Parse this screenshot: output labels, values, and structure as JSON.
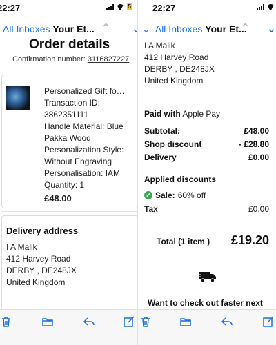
{
  "status_bar": {
    "left_time": "22:27",
    "right_time": "22:27",
    "battery": "5"
  },
  "nav": {
    "back_label": "All Inboxes",
    "subject": "Your Et..."
  },
  "order": {
    "title": "Order details",
    "confirmation_label": "Confirmation number:",
    "confirmation_number": "3116827227",
    "item": {
      "name": "Personalized Gift for ...",
      "transaction_label": "Transaction ID:",
      "transaction_id": "3862351111",
      "details": [
        "Handle Material: Blue",
        "Pakka Wood",
        "Personalization Style:",
        "Without Engraving",
        "Personalisation: IAM",
        "Quantity: 1"
      ],
      "price": "£48.00"
    }
  },
  "delivery": {
    "heading": "Delivery address",
    "lines": [
      "I A Malik",
      "412 Harvey Road",
      "DERBY , DE248JX",
      "United Kingdom"
    ]
  },
  "right_address": {
    "lines": [
      "I A Malik",
      "412 Harvey Road",
      "DERBY , DE248JX",
      "United Kingdom"
    ]
  },
  "payment": {
    "paid_label": "Paid with",
    "paid_method": "Apple Pay",
    "rows": [
      {
        "label": "Subtotal:",
        "value": "£48.00"
      },
      {
        "label": "Shop discount",
        "value": "- £28.80"
      },
      {
        "label": "Delivery",
        "value": "£0.00"
      }
    ],
    "applied_heading": "Applied discounts",
    "sale_label": "Sale:",
    "sale_value": "60% off",
    "tax_label": "Tax",
    "tax_value": "£0.00",
    "total_label": "Total (1 item )",
    "total_value": "£19.20",
    "checkout_prompt": "Want to check out faster next"
  },
  "toolbar": {
    "icons": [
      "trash-icon",
      "folder-icon",
      "reply-icon",
      "compose-icon"
    ]
  },
  "colors": {
    "link_blue": "#1a6fe6",
    "sale_green": "#3aa757",
    "battery_yellow": "#f4c430"
  }
}
